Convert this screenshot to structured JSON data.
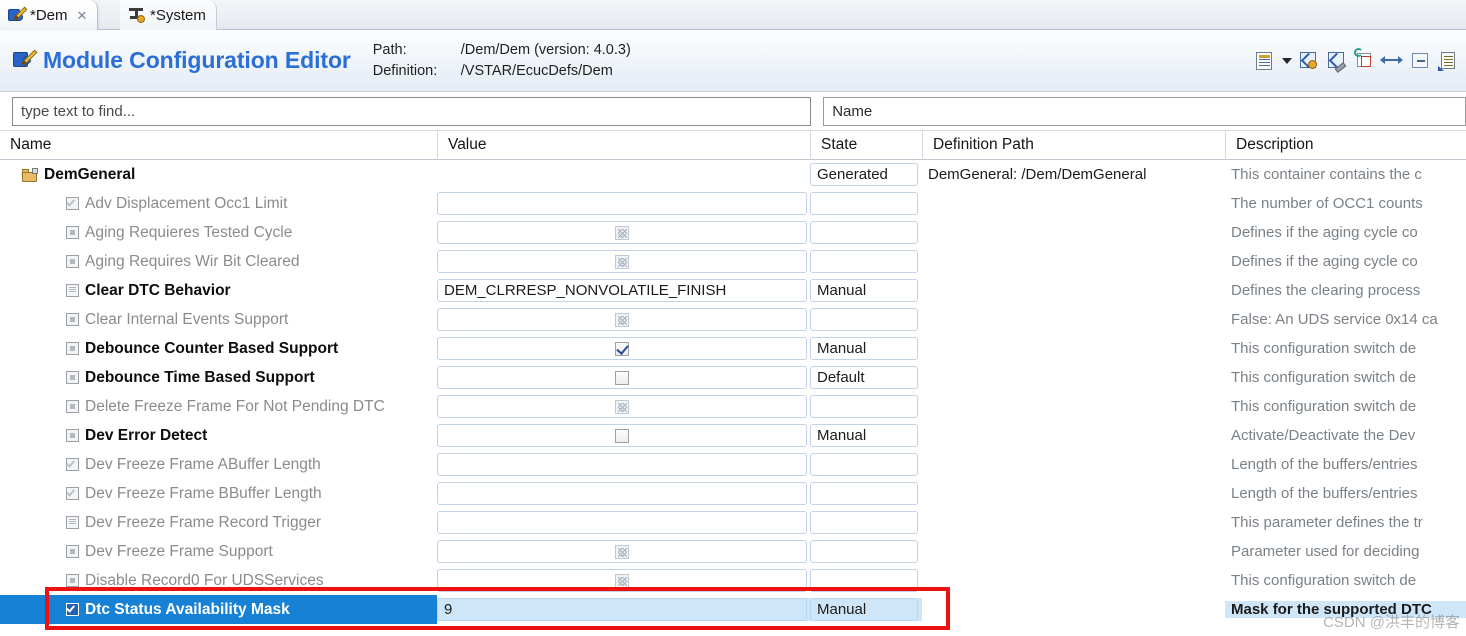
{
  "tabs": [
    {
      "label": "*Dem",
      "icon": "module-puzzle-icon",
      "active": true,
      "close": "✕"
    },
    {
      "label": "*System",
      "icon": "system-clamp-icon",
      "active": false
    }
  ],
  "header": {
    "icon": "module-puzzle-icon",
    "title": "Module Configuration Editor",
    "path_label": "Path:",
    "path_value": "/Dem/Dem  (version: 4.0.3)",
    "definition_label": "Definition:",
    "definition_value": "/VSTAR/EcucDefs/Dem",
    "tools": [
      {
        "name": "report-document-icon"
      },
      {
        "name": "chevron-down-icon"
      },
      {
        "name": "configure-link-icon"
      },
      {
        "name": "clean-link-icon"
      },
      {
        "name": "refresh-table-icon"
      },
      {
        "name": "fit-width-icon"
      },
      {
        "name": "collapse-all-icon"
      },
      {
        "name": "show-properties-icon"
      }
    ]
  },
  "search": {
    "find_placeholder": "type text to find...",
    "find_value": "",
    "name_value": "Name"
  },
  "table": {
    "columns": [
      "Name",
      "Value",
      "State",
      "Definition Path",
      "Description"
    ],
    "rows": [
      {
        "name": "DemGeneral",
        "level": "root",
        "icon": "folder-locked-icon",
        "enabled": true,
        "twisty": true,
        "value": "",
        "value_type": "none",
        "state": "Generated",
        "state_type": "box",
        "defpath": "DemGeneral:  /Dem/DemGeneral",
        "desc": "This container contains the c"
      },
      {
        "name": "Adv Displacement Occ1 Limit",
        "level": "child",
        "icon": "param-check-icon",
        "enabled": false,
        "value": "",
        "value_type": "blank",
        "state": "",
        "state_type": "box",
        "defpath": "",
        "desc": "The number of OCC1 counts"
      },
      {
        "name": "Aging Requieres Tested Cycle",
        "level": "child",
        "icon": "param-bool-icon",
        "enabled": false,
        "value": "",
        "value_type": "checkbox-grey",
        "state": "",
        "state_type": "box",
        "defpath": "",
        "desc": "Defines if the aging cycle co"
      },
      {
        "name": "Aging Requires Wir Bit Cleared",
        "level": "child",
        "icon": "param-bool-icon",
        "enabled": false,
        "value": "",
        "value_type": "checkbox-grey",
        "state": "",
        "state_type": "box",
        "defpath": "",
        "desc": "Defines if the aging cycle co"
      },
      {
        "name": "Clear DTC Behavior",
        "level": "child",
        "icon": "param-enum-icon",
        "enabled": true,
        "value": "DEM_CLRRESP_NONVOLATILE_FINISH",
        "value_type": "text",
        "state": "Manual",
        "state_type": "box",
        "defpath": "",
        "desc": "Defines the clearing process"
      },
      {
        "name": "Clear Internal Events Support",
        "level": "child",
        "icon": "param-bool-icon",
        "enabled": false,
        "value": "",
        "value_type": "checkbox-grey",
        "state": "",
        "state_type": "box",
        "defpath": "",
        "desc": "False: An UDS service 0x14 ca"
      },
      {
        "name": "Debounce Counter Based Support",
        "level": "child",
        "icon": "param-bool-icon",
        "enabled": true,
        "value": "",
        "value_type": "checkbox-checked",
        "state": "Manual",
        "state_type": "box",
        "defpath": "",
        "desc": "This configuration switch de"
      },
      {
        "name": "Debounce Time Based Support",
        "level": "child",
        "icon": "param-bool-icon",
        "enabled": true,
        "value": "",
        "value_type": "checkbox-unchecked",
        "state": "Default",
        "state_type": "box",
        "defpath": "",
        "desc": "This configuration switch de"
      },
      {
        "name": "Delete Freeze Frame For Not Pending DTC",
        "level": "child",
        "icon": "param-bool-icon",
        "enabled": false,
        "value": "",
        "value_type": "checkbox-grey",
        "state": "",
        "state_type": "box",
        "defpath": "",
        "desc": "This configuration switch de"
      },
      {
        "name": "Dev Error Detect",
        "level": "child",
        "icon": "param-bool-icon",
        "enabled": true,
        "value": "",
        "value_type": "checkbox-unchecked",
        "state": "Manual",
        "state_type": "box",
        "defpath": "",
        "desc": "Activate/Deactivate the Dev"
      },
      {
        "name": "Dev Freeze Frame ABuffer Length",
        "level": "child",
        "icon": "param-check-icon",
        "enabled": false,
        "value": "",
        "value_type": "blank",
        "state": "",
        "state_type": "box",
        "defpath": "",
        "desc": "Length of the buffers/entries"
      },
      {
        "name": "Dev Freeze Frame BBuffer Length",
        "level": "child",
        "icon": "param-check-icon",
        "enabled": false,
        "value": "",
        "value_type": "blank",
        "state": "",
        "state_type": "box",
        "defpath": "",
        "desc": "Length of the buffers/entries"
      },
      {
        "name": "Dev Freeze Frame Record Trigger",
        "level": "child",
        "icon": "param-enum-icon",
        "enabled": false,
        "value": "",
        "value_type": "blank",
        "state": "",
        "state_type": "box",
        "defpath": "",
        "desc": "This parameter defines the tr"
      },
      {
        "name": "Dev Freeze Frame Support",
        "level": "child",
        "icon": "param-bool-icon",
        "enabled": false,
        "value": "",
        "value_type": "checkbox-grey",
        "state": "",
        "state_type": "box",
        "defpath": "",
        "desc": "Parameter used for deciding"
      },
      {
        "name": "Disable Record0 For UDSServices",
        "level": "child",
        "icon": "param-bool-icon",
        "enabled": false,
        "value": "",
        "value_type": "checkbox-grey",
        "state": "",
        "state_type": "box",
        "defpath": "",
        "desc": "This configuration switch de"
      },
      {
        "name": "Dtc Status Availability Mask",
        "level": "child",
        "icon": "param-check-icon",
        "enabled": true,
        "selected": true,
        "value": "9",
        "value_type": "text",
        "state": "Manual",
        "state_type": "box",
        "defpath": "",
        "desc": "Mask for the supported DTC"
      }
    ]
  },
  "annotation": {
    "highlight_color": "#ee1111",
    "selection_color": "#1681d5"
  },
  "watermark": "CSDN @洪丰的博客"
}
